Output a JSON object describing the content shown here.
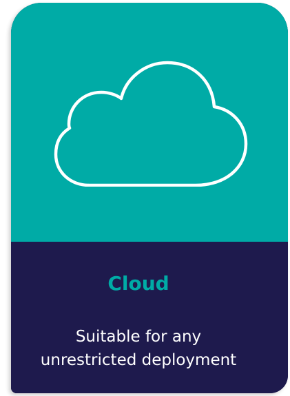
{
  "card": {
    "icon": "cloud-icon",
    "title": "Cloud",
    "description_line1": "Suitable for any",
    "description_line2": "unrestricted deployment"
  },
  "colors": {
    "teal": "#00aba6",
    "navy": "#1e1a4d",
    "white": "#ffffff"
  }
}
